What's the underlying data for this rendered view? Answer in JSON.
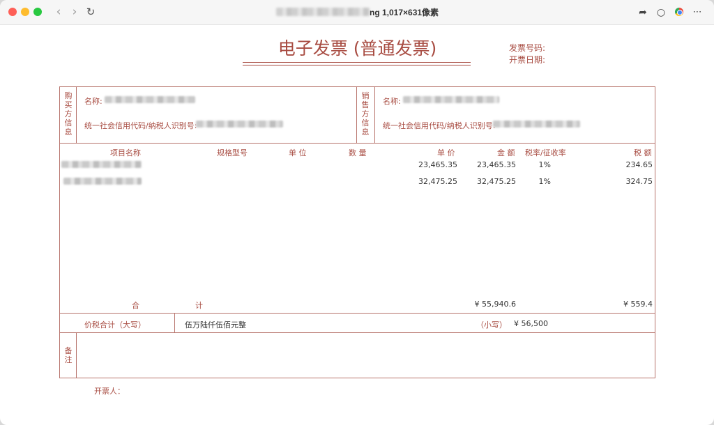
{
  "window": {
    "title_suffix": "ng 1,017×631像素"
  },
  "invoice": {
    "title": "电子发票 (普通发票)",
    "invoice_no_label": "发票号码:",
    "issue_date_label": "开票日期:",
    "buyer_vertical": [
      "购",
      "买",
      "方",
      "信",
      "息"
    ],
    "seller_vertical": [
      "销",
      "售",
      "方",
      "信",
      "息"
    ],
    "buyer_name_label": "名称:",
    "buyer_tax_label": "统一社会信用代码/纳税人识别号:",
    "seller_name_label": "名称:",
    "seller_tax_label": "统一社会信用代码/纳税人识别号:",
    "columns": {
      "item": "项目名称",
      "spec": "规格型号",
      "unit": "单 位",
      "qty": "数 量",
      "price": "单 价",
      "amount": "金 额",
      "rate": "税率/征收率",
      "tax": "税 额"
    },
    "rows": [
      {
        "price": "23,465.35",
        "amount": "23,465.35",
        "rate": "1%",
        "tax": "234.65"
      },
      {
        "price": "32,475.25",
        "amount": "32,475.25",
        "rate": "1%",
        "tax": "324.75"
      }
    ],
    "total_label_1": "合",
    "total_label_2": "计",
    "total_amount": "¥ 55,940.6",
    "total_tax": "¥ 559.4",
    "grand_label": "价税合计（大写）",
    "grand_words": "伍万陆仟伍佰元整",
    "grand_small_label": "（小写）",
    "grand_small_value": "¥ 56,500",
    "remarks_vertical": [
      "备",
      "注"
    ],
    "issuer_label": "开票人："
  }
}
